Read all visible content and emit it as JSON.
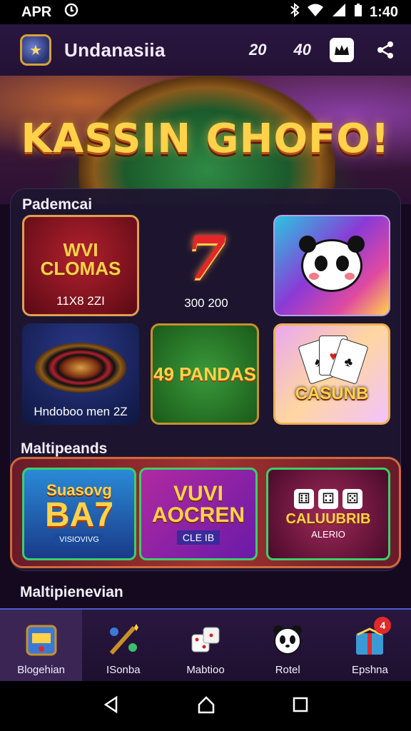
{
  "status_bar": {
    "left_text": "APR",
    "time": "1:40"
  },
  "header": {
    "title": "Undanasiia",
    "count_a": "20",
    "count_b": "40"
  },
  "hero": {
    "title": "KASSIN GHOFO!"
  },
  "sections": [
    {
      "label": "Pademcai"
    },
    {
      "label": "Maltipeands"
    },
    {
      "label": "Maltipienevian"
    }
  ],
  "grid_tiles": [
    {
      "title": "WVI CLOMAS",
      "caption": "11X8 2ZI"
    },
    {
      "title": "7",
      "caption": "300 200"
    },
    {
      "title": "",
      "caption": ""
    },
    {
      "title": "",
      "caption": "Hndoboo men 2Z"
    },
    {
      "title": "49 PANDAS",
      "caption": ""
    },
    {
      "title": "CASUNB",
      "caption": ""
    }
  ],
  "banners": [
    {
      "title": "Suasovg",
      "subtitle": "BA7",
      "tag": "VISIOVIVG"
    },
    {
      "title": "VUVI AOCREN",
      "subtitle": "CLE IB"
    },
    {
      "title": "CALUUBRIB",
      "subtitle": "ALERIO"
    }
  ],
  "nav": [
    {
      "label": "Blogehian",
      "icon": "slot-machine-icon"
    },
    {
      "label": "ISonba",
      "icon": "magic-wand-icon"
    },
    {
      "label": "Mabtioo",
      "icon": "dice-icon"
    },
    {
      "label": "Rotel",
      "icon": "panda-icon"
    },
    {
      "label": "Epshna",
      "icon": "gift-box-icon",
      "badge": "4"
    }
  ],
  "colors": {
    "accent_gold": "#ffd24a",
    "panel": "#1e1630",
    "nav_border": "#4a5fd0"
  }
}
